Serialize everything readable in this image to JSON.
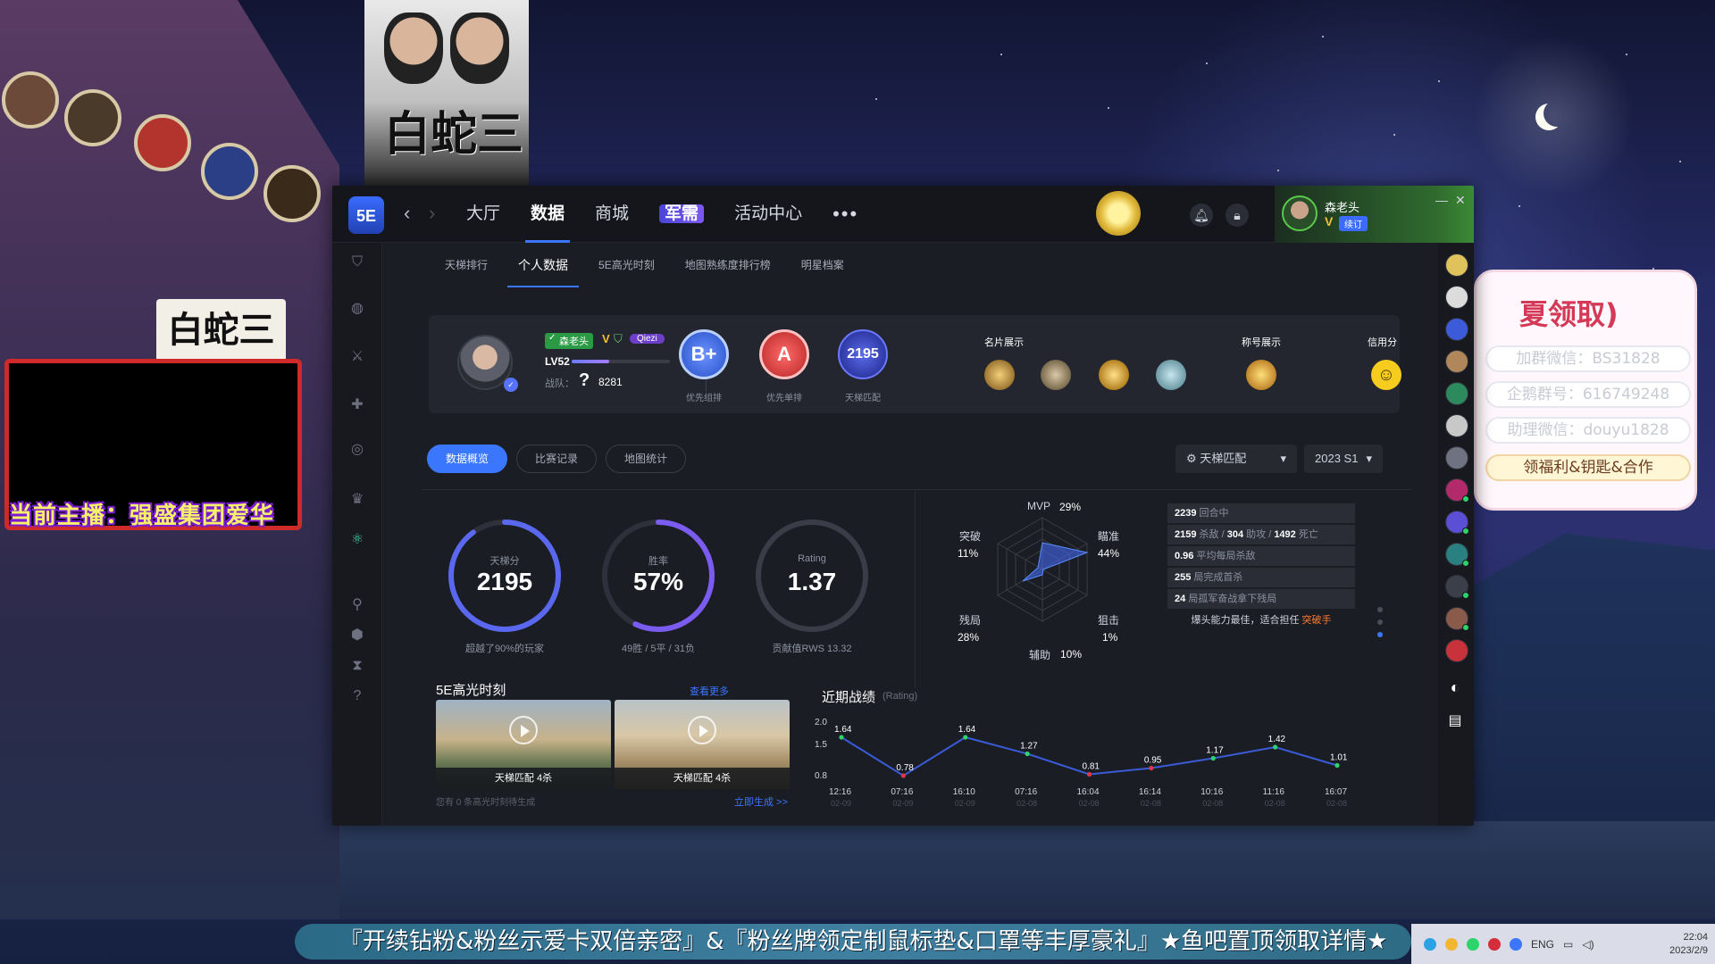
{
  "stream": {
    "poster_title": "白蛇三",
    "shop_sign": "白蛇三",
    "anchor_label": "当前主播：强盛集团爱华",
    "marquee": "『开续钻粉&粉丝示爱卡双倍亲密』&『粉丝牌领定制鼠标垫&口罩等丰厚豪礼』★鱼吧置顶领取详情★",
    "promo": {
      "title": "夏领取)",
      "rows": [
        "加群微信：BS31828",
        "企鹅群号：616749248",
        "助理微信：douyu1828",
        "领福利&钥匙&合作"
      ]
    },
    "taskbar": {
      "lang": "ENG",
      "time": "22:04",
      "date": "2023/2/9"
    }
  },
  "topbar": {
    "logo": "5E",
    "nav": [
      "大厅",
      "数据",
      "商城",
      "军需",
      "活动中心",
      "•••"
    ],
    "active_nav": "数据",
    "user": {
      "name": "森老头",
      "v": "V",
      "badge": "续订"
    }
  },
  "subtabs": [
    "天梯排行",
    "个人数据",
    "5E高光时刻",
    "地图熟练度排行榜",
    "明星档案"
  ],
  "profile": {
    "name": "森老头",
    "v": "V",
    "pill": "Qiezi",
    "level": "LV52",
    "level_progress": 0.38,
    "team_label": "战队：",
    "team_icon": "?",
    "team_id": "8281",
    "ranks": [
      {
        "value": "B+",
        "label": "优先组排",
        "color": "#3a64d8"
      },
      {
        "value": "A",
        "label": "优先单排",
        "color": "#cc3a3a"
      },
      {
        "value": "2195",
        "label": "天梯匹配",
        "color": "#3b48b8"
      }
    ],
    "card_title": "名片展示",
    "title_label": "称号展示",
    "credit_label": "信用分",
    "credit_icon": "smile-icon"
  },
  "filters": {
    "tabs": [
      "数据概览",
      "比赛记录",
      "地图统计"
    ],
    "mode": "天梯匹配",
    "season": "2023 S1"
  },
  "overview": {
    "rings": [
      {
        "label": "天梯分",
        "value": "2195",
        "sub": "超越了90%的玩家",
        "fraction": 0.9,
        "color": "#5a68f0"
      },
      {
        "label": "胜率",
        "value": "57%",
        "sub": "49胜 / 5平 / 31负",
        "fraction": 0.57,
        "color": "#7a5cf0"
      },
      {
        "label": "Rating",
        "value": "1.37",
        "sub": "贡献值RWS 13.32",
        "fraction": 0.0,
        "color": "#555a66"
      }
    ],
    "radar": [
      {
        "label": "MVP",
        "value": "29%"
      },
      {
        "label": "瞄准",
        "value": "44%"
      },
      {
        "label": "狙击",
        "value": "1%"
      },
      {
        "label": "辅助",
        "value": "10%"
      },
      {
        "label": "残局",
        "value": "28%"
      },
      {
        "label": "突破",
        "value": "11%"
      }
    ],
    "stats": [
      {
        "num": "2239",
        "text": "回合中"
      },
      {
        "num": "2159",
        "text": "杀敌 / ",
        "num2": "304",
        "text2": "助攻 / ",
        "num3": "1492",
        "text3": "死亡"
      },
      {
        "num": "0.96",
        "text": "平均每局杀敌"
      },
      {
        "num": "255",
        "text": "局完成首杀"
      },
      {
        "num": "24",
        "text": "局孤军奋战拿下残局"
      }
    ],
    "hint_prefix": "爆头能力最佳，适合担任",
    "hint_role": "突破手"
  },
  "highlights": {
    "title": "5E高光时刻",
    "more": "查看更多",
    "clips": [
      "天梯匹配 4杀",
      "天梯匹配 4杀"
    ],
    "note": "您有 0 条高光时刻待生成",
    "generate": "立即生成 >>"
  },
  "recent": {
    "title": "近期战绩",
    "subtitle": "(Rating)"
  },
  "chart_data": {
    "type": "line",
    "title": "近期战绩",
    "ylabel": "(Rating)",
    "x": [
      "12:16",
      "07:16",
      "16:10",
      "07:16",
      "16:04",
      "16:14",
      "10:16",
      "11:16",
      "16:07"
    ],
    "x_sub": [
      "02-09",
      "02-09",
      "02-09",
      "02-08",
      "02-08",
      "02-08",
      "02-08",
      "02-08",
      "02-08"
    ],
    "values": [
      1.64,
      0.78,
      1.64,
      1.27,
      0.81,
      0.95,
      1.17,
      1.42,
      1.01
    ],
    "yticks": [
      2.0,
      1.5,
      0.8
    ],
    "ylim": [
      0.8,
      2.0
    ],
    "threshold": 1.0,
    "colors": {
      "line": "#3a5bd8",
      "above": "#2fd36b",
      "below": "#e0364a"
    }
  }
}
